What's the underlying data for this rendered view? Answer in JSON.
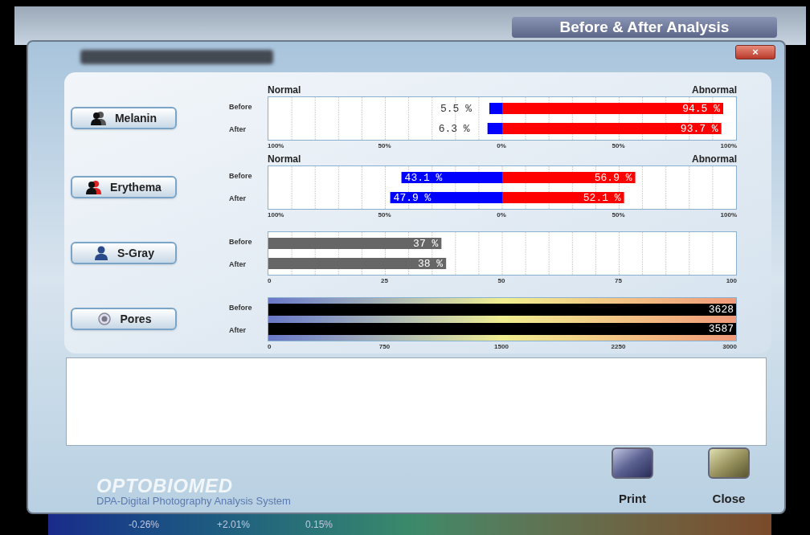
{
  "header": {
    "title": "Before & After Analysis"
  },
  "dialog": {
    "close_label": "×"
  },
  "sections": [
    {
      "button": {
        "label": "Melanin",
        "kind": "duo"
      },
      "left_heading": "Normal",
      "right_heading": "Abnormal",
      "chart_data": {
        "type": "bar",
        "orientation": "horizontal",
        "stacked": true,
        "grid": true,
        "categories": [
          "Before",
          "After"
        ],
        "xlim": [
          -100,
          100
        ],
        "xticks": [
          {
            "value": -100,
            "label": "100%"
          },
          {
            "value": -50,
            "label": "50%"
          },
          {
            "value": 0,
            "label": "0%"
          },
          {
            "value": 50,
            "label": "50%"
          },
          {
            "value": 100,
            "label": "100%"
          }
        ],
        "series": [
          {
            "color": "#0000ff",
            "values": [
              -5.5,
              -6.3
            ]
          },
          {
            "color": "#ff0000",
            "values": [
              94.5,
              93.7
            ]
          }
        ],
        "value_labels": [
          [
            "5.5 %",
            "6.3 %"
          ],
          [
            "94.5 %",
            "93.7 %"
          ]
        ]
      }
    },
    {
      "button": {
        "label": "Erythema",
        "kind": "duo"
      },
      "left_heading": "Normal",
      "right_heading": "Abnormal",
      "chart_data": {
        "type": "bar",
        "orientation": "horizontal",
        "stacked": true,
        "grid": true,
        "categories": [
          "Before",
          "After"
        ],
        "xlim": [
          -100,
          100
        ],
        "xticks": [
          {
            "value": -100,
            "label": "100%"
          },
          {
            "value": -50,
            "label": "50%"
          },
          {
            "value": 0,
            "label": "0%"
          },
          {
            "value": 50,
            "label": "50%"
          },
          {
            "value": 100,
            "label": "100%"
          }
        ],
        "series": [
          {
            "color": "#0000ff",
            "values": [
              -43.1,
              -47.9
            ]
          },
          {
            "color": "#ff0000",
            "values": [
              56.9,
              52.1
            ]
          }
        ],
        "value_labels": [
          [
            "43.1 %",
            "47.9 %"
          ],
          [
            "56.9 %",
            "52.1 %"
          ]
        ]
      }
    },
    {
      "button": {
        "label": "S-Gray",
        "kind": "single"
      },
      "chart_data": {
        "type": "bar",
        "orientation": "horizontal",
        "grid": true,
        "categories": [
          "Before",
          "After"
        ],
        "xlim": [
          0,
          100
        ],
        "xticks": [
          0,
          25,
          50,
          75,
          100
        ],
        "series": [
          {
            "color": "#666666",
            "values": [
              37,
              38
            ]
          }
        ],
        "value_labels": [
          [
            "37 %",
            "38 %"
          ]
        ]
      }
    },
    {
      "button": {
        "label": "Pores",
        "kind": "dot"
      },
      "gauge": {
        "categories": [
          "Before",
          "After"
        ],
        "readings": [
          "3628",
          "3587"
        ],
        "scale": [
          "0",
          "750",
          "1500",
          "2250",
          "3000"
        ]
      }
    }
  ],
  "footer": {
    "logo": "OPTOBIOMED",
    "product": "DPA-Digital Photography Analysis System",
    "buttons": [
      "Print",
      "Close"
    ]
  },
  "background_values": [
    "-0.26%",
    "+2.01%",
    "0.15%"
  ]
}
